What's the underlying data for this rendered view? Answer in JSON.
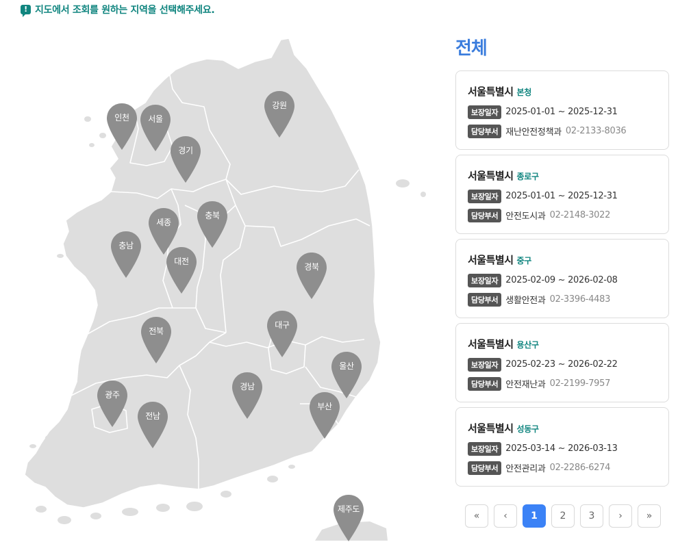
{
  "notice": {
    "icon": "alert-message-icon",
    "text": "지도에서 조회를 원하는 지역을 선택해주세요."
  },
  "colors": {
    "accent": "#10857f",
    "title": "#3b7ddd",
    "pin": "#8e8e8e",
    "map": "#dedede",
    "active_page": "#3b82f6"
  },
  "map": {
    "regions": [
      {
        "id": "incheon",
        "label": "인천"
      },
      {
        "id": "seoul",
        "label": "서울"
      },
      {
        "id": "gyeonggi",
        "label": "경기"
      },
      {
        "id": "gangwon",
        "label": "강원"
      },
      {
        "id": "sejong",
        "label": "세종"
      },
      {
        "id": "chungbuk",
        "label": "충북"
      },
      {
        "id": "chungnam",
        "label": "충남"
      },
      {
        "id": "daejeon",
        "label": "대전"
      },
      {
        "id": "gyeongbuk",
        "label": "경북"
      },
      {
        "id": "jeonbuk",
        "label": "전북"
      },
      {
        "id": "daegu",
        "label": "대구"
      },
      {
        "id": "ulsan",
        "label": "울산"
      },
      {
        "id": "gwangju",
        "label": "광주"
      },
      {
        "id": "gyeongnam",
        "label": "경남"
      },
      {
        "id": "busan",
        "label": "부산"
      },
      {
        "id": "jeonnam",
        "label": "전남"
      },
      {
        "id": "jeju",
        "label": "제주도"
      }
    ]
  },
  "panel": {
    "title": "전체",
    "date_tag": "보장일자",
    "dept_tag": "담당부서",
    "items": [
      {
        "city": "서울특별시",
        "district": "본청",
        "period": "2025-01-01 ~ 2025-12-31",
        "dept": "재난안전정책과",
        "phone": "02-2133-8036"
      },
      {
        "city": "서울특별시",
        "district": "종로구",
        "period": "2025-01-01 ~ 2025-12-31",
        "dept": "안전도시과",
        "phone": "02-2148-3022"
      },
      {
        "city": "서울특별시",
        "district": "중구",
        "period": "2025-02-09 ~ 2026-02-08",
        "dept": "생활안전과",
        "phone": "02-3396-4483"
      },
      {
        "city": "서울특별시",
        "district": "용산구",
        "period": "2025-02-23 ~ 2026-02-22",
        "dept": "안전재난과",
        "phone": "02-2199-7957"
      },
      {
        "city": "서울특별시",
        "district": "성동구",
        "period": "2025-03-14 ~ 2026-03-13",
        "dept": "안전관리과",
        "phone": "02-2286-6274"
      }
    ]
  },
  "pagination": {
    "first": "«",
    "prev": "‹",
    "next": "›",
    "last": "»",
    "pages": [
      "1",
      "2",
      "3"
    ],
    "current": "1"
  }
}
